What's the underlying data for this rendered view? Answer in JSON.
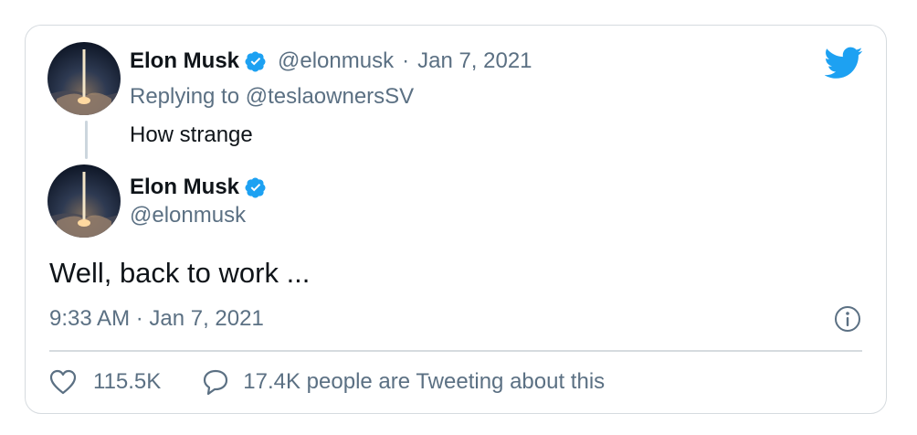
{
  "quoted_tweet": {
    "author_name": "Elon Musk",
    "handle": "@elonmusk",
    "separator": "·",
    "date": "Jan 7, 2021",
    "replying_to": "Replying to @teslaownersSV",
    "text": "How strange"
  },
  "main_tweet": {
    "author_name": "Elon Musk",
    "handle": "@elonmusk",
    "text": "Well, back to work ...",
    "timestamp": "9:33 AM · Jan 7, 2021"
  },
  "actions": {
    "likes": "115.5K",
    "comments_label": "17.4K people are Tweeting about this"
  },
  "icons": {
    "brand": "twitter-bird-icon",
    "verified": "verified-badge-icon",
    "info": "info-icon",
    "like": "heart-icon",
    "comment": "speech-bubble-icon"
  },
  "colors": {
    "brand_blue": "#1da1f2",
    "text_primary": "#0f1419",
    "text_secondary": "#5b7083",
    "border": "#d6dbdf"
  }
}
